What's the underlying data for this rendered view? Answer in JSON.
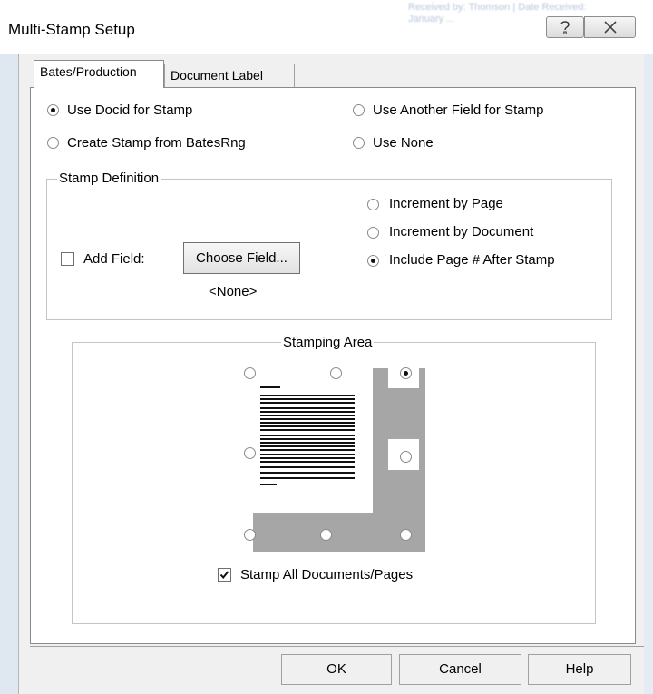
{
  "window": {
    "title": "Multi-Stamp Setup",
    "help_icon": "help-question-icon",
    "close_icon": "close-x-icon",
    "background_text": "Received by: Thomson | Date Received: January ..."
  },
  "tabs": [
    {
      "label": "Bates/Production",
      "active": true
    },
    {
      "label": "Document Label",
      "active": false
    }
  ],
  "stamp_source": {
    "options": [
      {
        "label": "Use Docid for Stamp",
        "selected": true
      },
      {
        "label": "Use Another Field for Stamp",
        "selected": false
      },
      {
        "label": "Create Stamp from BatesRng",
        "selected": false
      },
      {
        "label": "Use None",
        "selected": false
      }
    ]
  },
  "stamp_definition": {
    "title": "Stamp Definition",
    "add_field_label": "Add Field:",
    "add_field_checked": false,
    "choose_field_label": "Choose Field...",
    "field_value": "<None>",
    "increment_options": [
      {
        "label": "Increment by Page",
        "selected": false
      },
      {
        "label": "Increment by Document",
        "selected": false
      },
      {
        "label": "Include Page # After Stamp",
        "selected": true
      }
    ]
  },
  "stamping_area": {
    "title": "Stamping Area",
    "selected_position": "top-right",
    "positions": [
      "top-left",
      "top-center",
      "top-right",
      "middle-left",
      "middle-right",
      "bottom-left",
      "bottom-center",
      "bottom-right"
    ],
    "stamp_all_label": "Stamp All Documents/Pages",
    "stamp_all_checked": true
  },
  "footer_buttons": {
    "ok": "OK",
    "cancel": "Cancel",
    "help": "Help"
  },
  "colors": {
    "panel_bg": "#ffffff",
    "dialog_bg": "#f0f0f0",
    "shadow": "#a6a6a6"
  }
}
